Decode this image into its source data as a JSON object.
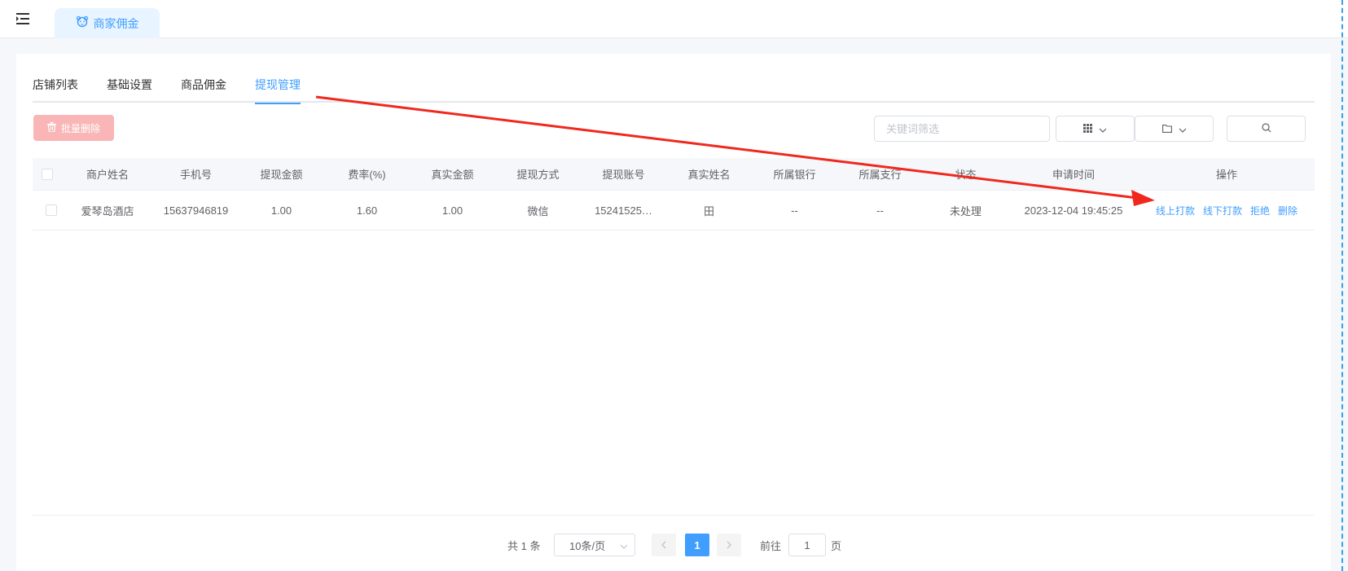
{
  "header": {
    "tag_label": "商家佣金"
  },
  "tabs": [
    {
      "label": "店铺列表"
    },
    {
      "label": "基础设置"
    },
    {
      "label": "商品佣金"
    },
    {
      "label": "提现管理"
    }
  ],
  "toolbar": {
    "batch_delete_label": "批量删除",
    "search_placeholder": "关键词筛选"
  },
  "table": {
    "columns": [
      "商户姓名",
      "手机号",
      "提现金额",
      "费率(%)",
      "真实金额",
      "提现方式",
      "提现账号",
      "真实姓名",
      "所属银行",
      "所属支行",
      "状态",
      "申请时间",
      "操作"
    ],
    "rows": [
      {
        "merchant_name": "爱琴岛酒店",
        "phone": "15637946819",
        "amount": "1.00",
        "rate": "1.60",
        "real_amount": "1.00",
        "method": "微信",
        "account": "15241525…",
        "real_name": "田",
        "bank": "--",
        "branch": "--",
        "status": "未处理",
        "apply_time": "2023-12-04 19:45:25",
        "actions": [
          "线上打款",
          "线下打款",
          "拒绝",
          "删除"
        ]
      }
    ]
  },
  "pagination": {
    "total_text": "共 1 条",
    "page_size": "10条/页",
    "current_page": "1",
    "goto_prefix": "前往",
    "goto_value": "1",
    "goto_suffix": "页"
  },
  "colors": {
    "accent": "#409eff",
    "danger_disabled": "#fab6b6",
    "annotation_arrow": "#f0281e"
  }
}
